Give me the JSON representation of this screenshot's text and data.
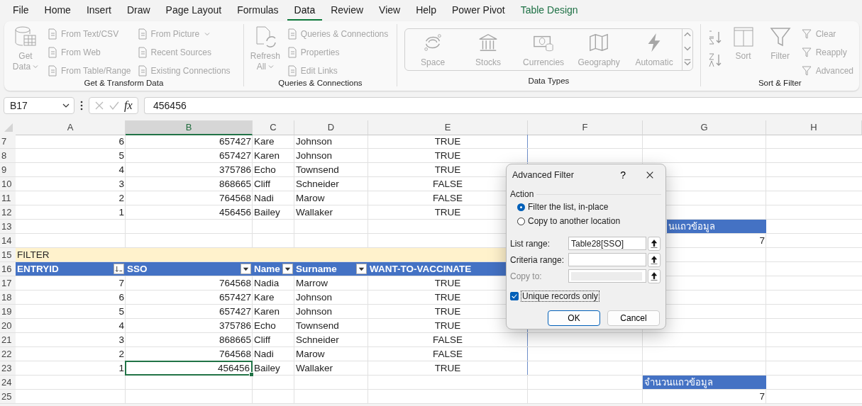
{
  "menu_tabs": [
    {
      "label": "File",
      "selected": false,
      "kind": "normal"
    },
    {
      "label": "Home",
      "selected": false,
      "kind": "normal"
    },
    {
      "label": "Insert",
      "selected": false,
      "kind": "normal"
    },
    {
      "label": "Draw",
      "selected": false,
      "kind": "normal"
    },
    {
      "label": "Page Layout",
      "selected": false,
      "kind": "normal"
    },
    {
      "label": "Formulas",
      "selected": false,
      "kind": "normal"
    },
    {
      "label": "Data",
      "selected": true,
      "kind": "normal"
    },
    {
      "label": "Review",
      "selected": false,
      "kind": "normal"
    },
    {
      "label": "View",
      "selected": false,
      "kind": "normal"
    },
    {
      "label": "Help",
      "selected": false,
      "kind": "normal"
    },
    {
      "label": "Power Pivot",
      "selected": false,
      "kind": "normal"
    },
    {
      "label": "Table Design",
      "selected": false,
      "kind": "contextual"
    }
  ],
  "ribbon": {
    "groups": [
      {
        "label": "Get & Transform Data",
        "columns": [
          {
            "kind": "large",
            "items": [
              {
                "label": "Get Data",
                "disabled": true,
                "dropdown": true
              }
            ]
          },
          {
            "kind": "small",
            "items": [
              {
                "label": "From Text/CSV",
                "disabled": true,
                "dropdown": false
              },
              {
                "label": "From Web",
                "disabled": true,
                "dropdown": false
              },
              {
                "label": "From Table/Range",
                "disabled": true,
                "dropdown": false
              }
            ]
          },
          {
            "kind": "small",
            "items": [
              {
                "label": "From Picture",
                "disabled": true,
                "dropdown": true
              },
              {
                "label": "Recent Sources",
                "disabled": true,
                "dropdown": false
              },
              {
                "label": "Existing Connections",
                "disabled": true,
                "dropdown": false
              }
            ]
          }
        ]
      },
      {
        "label": "Queries & Connections",
        "columns": [
          {
            "kind": "large",
            "items": [
              {
                "label": "Refresh All",
                "disabled": true,
                "dropdown": true
              }
            ]
          },
          {
            "kind": "small",
            "items": [
              {
                "label": "Queries & Connections",
                "disabled": true,
                "dropdown": false
              },
              {
                "label": "Properties",
                "disabled": true,
                "dropdown": false
              },
              {
                "label": "Edit Links",
                "disabled": true,
                "dropdown": false
              }
            ]
          }
        ]
      },
      {
        "label": "Data Types",
        "columns": [
          {
            "kind": "gallery",
            "items": [
              {
                "label": "Space",
                "disabled": true
              },
              {
                "label": "Stocks",
                "disabled": true
              },
              {
                "label": "Currencies",
                "disabled": true
              },
              {
                "label": "Geography",
                "disabled": true
              },
              {
                "label": "Automatic",
                "disabled": true
              }
            ]
          }
        ]
      },
      {
        "label": "Sort & Filter",
        "columns": [
          {
            "kind": "sort_arrows"
          },
          {
            "kind": "large",
            "items": [
              {
                "label": "Sort",
                "disabled": true,
                "dropdown": false
              }
            ]
          },
          {
            "kind": "large",
            "items": [
              {
                "label": "Filter",
                "disabled": true,
                "dropdown": false
              }
            ]
          },
          {
            "kind": "small_filter",
            "items": [
              {
                "label": "Clear",
                "disabled": true,
                "dropdown": false
              },
              {
                "label": "Reapply",
                "disabled": true,
                "dropdown": false
              },
              {
                "label": "Advanced",
                "disabled": true,
                "dropdown": false
              }
            ]
          }
        ]
      }
    ]
  },
  "formula_bar": {
    "name_box": "B17",
    "function_label": "fx",
    "formula": "456456"
  },
  "grid": {
    "columns": [
      {
        "label": "A",
        "selected": false
      },
      {
        "label": "B",
        "selected": true
      },
      {
        "label": "C",
        "selected": false
      },
      {
        "label": "D",
        "selected": false
      },
      {
        "label": "E",
        "selected": false
      },
      {
        "label": "F",
        "selected": false
      },
      {
        "label": "G",
        "selected": false
      },
      {
        "label": "H",
        "selected": false
      }
    ],
    "rows": [
      {
        "number": "7",
        "kind": "table",
        "selected": false,
        "a": "6",
        "b": "657427",
        "c": "Kare",
        "d": "Johnson",
        "e": "TRUE"
      },
      {
        "number": "8",
        "kind": "table",
        "selected": false,
        "a": "5",
        "b": "657427",
        "c": "Karen",
        "d": "Johnson",
        "e": "TRUE"
      },
      {
        "number": "9",
        "kind": "table",
        "selected": false,
        "a": "4",
        "b": "375786",
        "c": "Echo",
        "d": "Townsend",
        "e": "TRUE"
      },
      {
        "number": "10",
        "kind": "table",
        "selected": false,
        "a": "3",
        "b": "868665",
        "c": "Cliff",
        "d": "Schneider",
        "e": "FALSE"
      },
      {
        "number": "11",
        "kind": "table",
        "selected": false,
        "a": "2",
        "b": "764568",
        "c": "Nadi",
        "d": "Marow",
        "e": "FALSE"
      },
      {
        "number": "12",
        "kind": "table",
        "selected": false,
        "a": "1",
        "b": "456456",
        "c": "Bailey",
        "d": "Wallaker",
        "e": "TRUE"
      },
      {
        "number": "13",
        "kind": "summary_header",
        "covered": true,
        "g": "นแถวข้อมูล"
      },
      {
        "number": "14",
        "kind": "summary_value",
        "covered": true,
        "g": "7"
      },
      {
        "number": "15",
        "kind": "title",
        "a": "FILTER"
      },
      {
        "number": "16",
        "kind": "header",
        "headers": [
          {
            "label": "ENTRYID",
            "sorted": true
          },
          {
            "label": "SSO",
            "sorted": false
          },
          {
            "label": "Name",
            "sorted": false
          },
          {
            "label": "Surname",
            "sorted": false
          },
          {
            "label": "WANT-TO-VACCINATE"
          }
        ]
      },
      {
        "number": "17",
        "kind": "table",
        "selected": false,
        "a": "7",
        "b": "764568",
        "c": "Nadia",
        "d": "Marrow",
        "e": "TRUE"
      },
      {
        "number": "18",
        "kind": "table",
        "selected": false,
        "a": "6",
        "b": "657427",
        "c": "Kare",
        "d": "Johnson",
        "e": "TRUE"
      },
      {
        "number": "19",
        "kind": "table",
        "selected": false,
        "a": "5",
        "b": "657427",
        "c": "Karen",
        "d": "Johnson",
        "e": "TRUE"
      },
      {
        "number": "20",
        "kind": "table",
        "selected": false,
        "a": "4",
        "b": "375786",
        "c": "Echo",
        "d": "Townsend",
        "e": "TRUE"
      },
      {
        "number": "21",
        "kind": "table",
        "selected": false,
        "a": "3",
        "b": "868665",
        "c": "Cliff",
        "d": "Schneider",
        "e": "FALSE"
      },
      {
        "number": "22",
        "kind": "table",
        "selected": false,
        "a": "2",
        "b": "764568",
        "c": "Nadi",
        "d": "Marow",
        "e": "FALSE"
      },
      {
        "number": "23",
        "kind": "table",
        "selected": true,
        "a": "1",
        "b": "456456",
        "c": "Bailey",
        "d": "Wallaker",
        "e": "TRUE"
      },
      {
        "number": "24",
        "kind": "summary_header",
        "covered": false,
        "g": "จำนวนแถวข้อมูล"
      },
      {
        "number": "25",
        "kind": "summary_value",
        "covered": false,
        "g": "7"
      }
    ]
  },
  "dialog": {
    "title": "Advanced Filter",
    "help": "?",
    "section": "Action",
    "radios": [
      {
        "label": "Filter the list, in-place",
        "selected": true
      },
      {
        "label": "Copy to another location",
        "selected": false
      }
    ],
    "fields": [
      {
        "label": "List range:",
        "value": "Table28[SSO]",
        "disabled": false
      },
      {
        "label": "Criteria range:",
        "disabled": false
      },
      {
        "label": "Copy to:",
        "disabled": true
      }
    ],
    "checkbox": {
      "label": "Unique records only",
      "checked": true
    },
    "buttons": [
      {
        "label": "OK",
        "default": true
      },
      {
        "label": "Cancel",
        "default": false
      }
    ]
  }
}
